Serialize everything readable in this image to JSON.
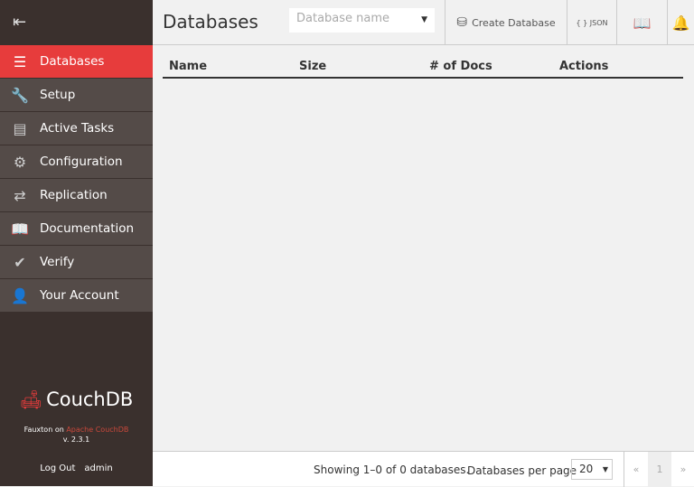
{
  "sidebar": {
    "items": [
      {
        "label": "Databases",
        "icon": "database-icon",
        "glyph": "☰",
        "active": true
      },
      {
        "label": "Setup",
        "icon": "wrench-icon",
        "glyph": "🔧"
      },
      {
        "label": "Active Tasks",
        "icon": "tasks-icon",
        "glyph": "▤"
      },
      {
        "label": "Configuration",
        "icon": "gear-icon",
        "glyph": "⚙"
      },
      {
        "label": "Replication",
        "icon": "replication-icon",
        "glyph": "⇄"
      },
      {
        "label": "Documentation",
        "icon": "book-icon",
        "glyph": "📖"
      },
      {
        "label": "Verify",
        "icon": "check-circle-icon",
        "glyph": "✔"
      },
      {
        "label": "Your Account",
        "icon": "user-icon",
        "glyph": "👤"
      }
    ],
    "logo_text": "CouchDB",
    "fauxton_on": "Fauxton on",
    "couchdb_link": "Apache CouchDB",
    "version": "v. 2.3.1",
    "logout": "Log Out",
    "user": "admin"
  },
  "header": {
    "title": "Databases",
    "search_placeholder": "Database name",
    "create": "Create Database",
    "json": "{ } JSON"
  },
  "table": {
    "columns": [
      "Name",
      "Size",
      "# of Docs",
      "Actions"
    ],
    "rows": []
  },
  "footer": {
    "showing": "Showing 1–0 of 0 databases.",
    "per_page_label": "Databases per page",
    "per_page": "20",
    "prev": "«",
    "page": "1",
    "next": "»"
  },
  "colors": {
    "accent": "#e73c3c",
    "sidebar": "#3a302d"
  }
}
